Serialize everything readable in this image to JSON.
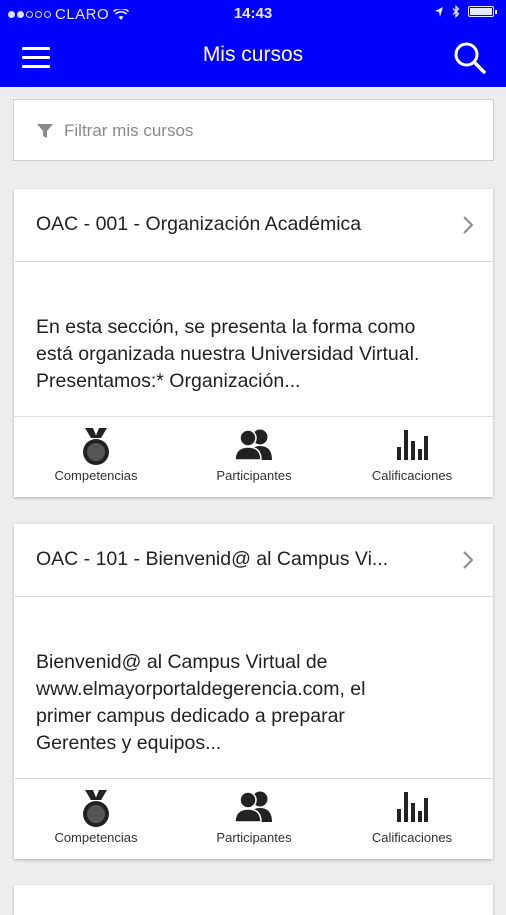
{
  "status_bar": {
    "carrier": "CLARO",
    "time": "14:43"
  },
  "header": {
    "title": "Mis cursos"
  },
  "filter": {
    "placeholder": "Filtrar mis cursos"
  },
  "courses": [
    {
      "title": "OAC - 001 - Organización Académica",
      "description": [
        "En esta sección, se presenta la forma como",
        "está organizada nuestra Universidad Virtual.",
        "Presentamos:* Organización..."
      ],
      "actions": [
        "Competencias",
        "Participantes",
        "Calificaciones"
      ]
    },
    {
      "title": "OAC - 101 - Bienvenid@ al Campus Vi...",
      "description": [
        "Bienvenid@ al Campus Virtual de",
        "www.elmayorportaldegerencia.com, el",
        "primer campus dedicado a preparar",
        "Gerentes y equipos..."
      ],
      "actions": [
        "Competencias",
        "Participantes",
        "Calificaciones"
      ]
    }
  ],
  "colors": {
    "header_bg": "#0000fe",
    "page_bg": "#ededed"
  },
  "icons": [
    "menu-icon",
    "search-icon",
    "filter-icon",
    "chevron-right-icon",
    "medal-icon",
    "participants-icon",
    "bar-chart-icon"
  ]
}
